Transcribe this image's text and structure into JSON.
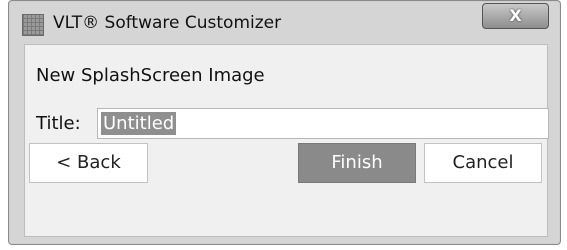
{
  "window": {
    "title": "VLT® Software Customizer",
    "close_label": "X"
  },
  "dialog": {
    "heading": "New SplashScreen Image",
    "title_field": {
      "label": "Title:",
      "value": "Untitled"
    }
  },
  "buttons": {
    "back": "< Back",
    "finish": "Finish",
    "cancel": "Cancel"
  },
  "icons": {
    "app": "grid-app-icon",
    "close": "close-icon"
  }
}
